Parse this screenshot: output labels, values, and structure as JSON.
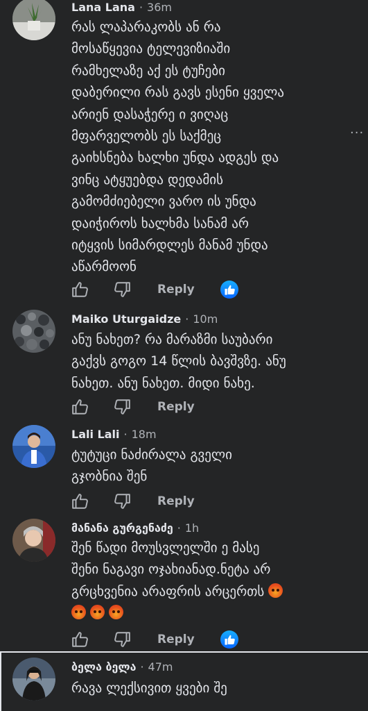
{
  "comments": [
    {
      "author": "Lana Lana",
      "time": "36m",
      "lines": [
        "რას ლაპარაკობს ან რა",
        "მოსაწყევია ტელევიზიაში",
        "რამხელაზე აქ ეს ტუჩები",
        "დაბერილი რას გავს ესენი ყველა",
        "არიენ დასაჭერე ი ვიღაც",
        "მფარველობს ეს საქმეც",
        "გაიხსნება ხალხი უნდა ადგეს და",
        "ვინც ატყუებდა დედამის",
        "გამომძიებელი ვარო ის უნდა",
        "დაიჭიროს ხალხმა სანამ არ",
        "იტყვის სიმარდლეს მანამ უნდა",
        "აწარმოონ"
      ],
      "reply_label": "Reply",
      "has_like_reaction": true
    },
    {
      "author": "Maiko Uturgaidze",
      "time": "10m",
      "lines": [
        "ანუ ნახეთ? რა მარაზმი საუბარი",
        "გაქვს გოგო 14 წლის ბავშვზე. ანუ",
        "ნახეთ. ანუ ნახეთ. მიდი ნახე."
      ],
      "reply_label": "Reply",
      "has_like_reaction": false
    },
    {
      "author": "Lali Lali",
      "time": "18m",
      "lines": [
        "ტუტუცი ნაძირალა გველი",
        "გჯობნია შენ"
      ],
      "reply_label": "Reply",
      "has_like_reaction": false
    },
    {
      "author": "მანანა გურგენაძე",
      "time": "1h",
      "lines": [
        "შენ წადი მოუსვლელში ე მასე",
        "შენი ნაგავი ოჯახიანად.ნეტა არ",
        "გრცხვენია არაფრის არცერთს"
      ],
      "reply_label": "Reply",
      "has_like_reaction": true,
      "emojis": [
        "angry-face",
        "angry-face",
        "angry-face",
        "angry-face"
      ]
    },
    {
      "author": "ბელა ბელა",
      "time": "47m",
      "lines": [
        "რავა ლექსივით ყვები შე"
      ]
    }
  ],
  "separator": "·",
  "more_label": "···",
  "colors": {
    "background": "#242526",
    "text_primary": "#e4e6eb",
    "text_secondary": "#b0b3b8",
    "like_blue": "#0866ff",
    "angry_orange": "#e8501e"
  },
  "icons": {
    "like": "thumbs-up-icon",
    "dislike": "thumbs-down-icon",
    "reaction": "like-reaction-icon",
    "more": "more-options-icon"
  }
}
